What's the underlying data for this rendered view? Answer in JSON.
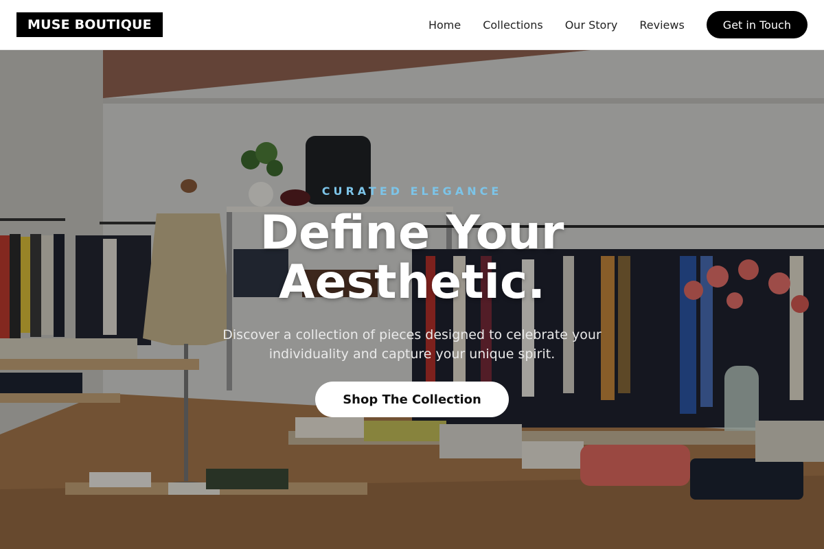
{
  "brand": {
    "name": "MUSE BOUTIQUE"
  },
  "nav": {
    "links": [
      "Home",
      "Collections",
      "Our Story",
      "Reviews"
    ],
    "cta_label": "Get in Touch"
  },
  "hero": {
    "eyebrow": "CURATED ELEGANCE",
    "title": "Define Your Aesthetic.",
    "subtitle": "Discover a collection of pieces designed to celebrate your individuality and capture your unique spirit.",
    "button_label": "Shop The Collection",
    "image_subject": "boutique-store-interior-photo"
  },
  "colors": {
    "header_bg": "#ffffff",
    "brand_bg": "#000000",
    "cta_bg": "#000000",
    "eyebrow": "#7cc4e8",
    "hero_text": "#ffffff",
    "button_bg": "#ffffff"
  }
}
